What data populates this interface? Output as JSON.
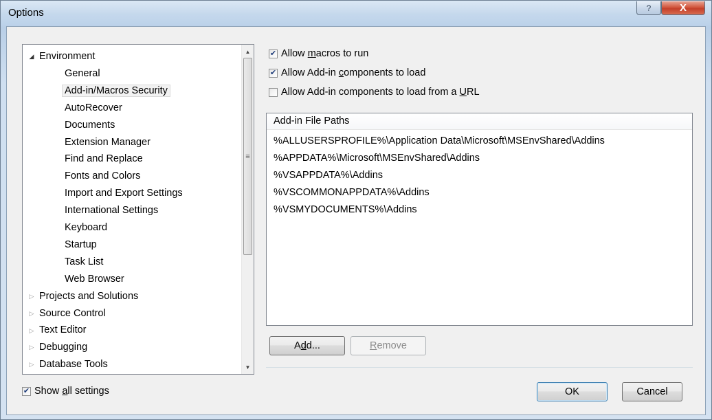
{
  "window": {
    "title": "Options",
    "help_glyph": "?",
    "close_glyph": "X"
  },
  "tree": {
    "items": [
      {
        "label": "Environment",
        "level": 0,
        "arrow": "expanded"
      },
      {
        "label": "General",
        "level": 1
      },
      {
        "label": "Add-in/Macros Security",
        "level": 1,
        "selected": true
      },
      {
        "label": "AutoRecover",
        "level": 1
      },
      {
        "label": "Documents",
        "level": 1
      },
      {
        "label": "Extension Manager",
        "level": 1
      },
      {
        "label": "Find and Replace",
        "level": 1
      },
      {
        "label": "Fonts and Colors",
        "level": 1
      },
      {
        "label": "Import and Export Settings",
        "level": 1
      },
      {
        "label": "International Settings",
        "level": 1
      },
      {
        "label": "Keyboard",
        "level": 1
      },
      {
        "label": "Startup",
        "level": 1
      },
      {
        "label": "Task List",
        "level": 1
      },
      {
        "label": "Web Browser",
        "level": 1
      },
      {
        "label": "Projects and Solutions",
        "level": 0,
        "arrow": "collapsed"
      },
      {
        "label": "Source Control",
        "level": 0,
        "arrow": "collapsed"
      },
      {
        "label": "Text Editor",
        "level": 0,
        "arrow": "collapsed"
      },
      {
        "label": "Debugging",
        "level": 0,
        "arrow": "collapsed"
      },
      {
        "label": "Database Tools",
        "level": 0,
        "arrow": "collapsed"
      }
    ]
  },
  "options": {
    "allow_macros": {
      "pre": "Allow ",
      "key": "m",
      "post": "acros to run",
      "checked": true
    },
    "allow_addins": {
      "pre": "Allow Add-in ",
      "key": "c",
      "post": "omponents to load",
      "checked": true
    },
    "allow_addins_url": {
      "pre": "Allow Add-in components to load from a ",
      "key": "U",
      "post": "RL",
      "checked": false
    }
  },
  "paths": {
    "header": "Add-in File Paths",
    "rows": [
      "%ALLUSERSPROFILE%\\Application Data\\Microsoft\\MSEnvShared\\Addins",
      "%APPDATA%\\Microsoft\\MSEnvShared\\Addins",
      "%VSAPPDATA%\\Addins",
      "%VSCOMMONAPPDATA%\\Addins",
      "%VSMYDOCUMENTS%\\Addins"
    ]
  },
  "buttons": {
    "add": {
      "pre": "A",
      "key": "d",
      "post": "d..."
    },
    "remove": {
      "pre": "",
      "key": "R",
      "post": "emove"
    },
    "ok": "OK",
    "cancel": "Cancel"
  },
  "show_all": {
    "pre": "Show ",
    "key": "a",
    "post": "ll settings",
    "checked": true
  },
  "colors": {
    "title_gradient": "#c5d8ec",
    "close_button": "#c4402a",
    "check_mark": "#1f3d7a",
    "default_button_border": "#3c7fb1"
  },
  "icons": {
    "check": "check-icon",
    "tree_expanded": "triangle-down-icon",
    "tree_collapsed": "triangle-right-icon"
  }
}
